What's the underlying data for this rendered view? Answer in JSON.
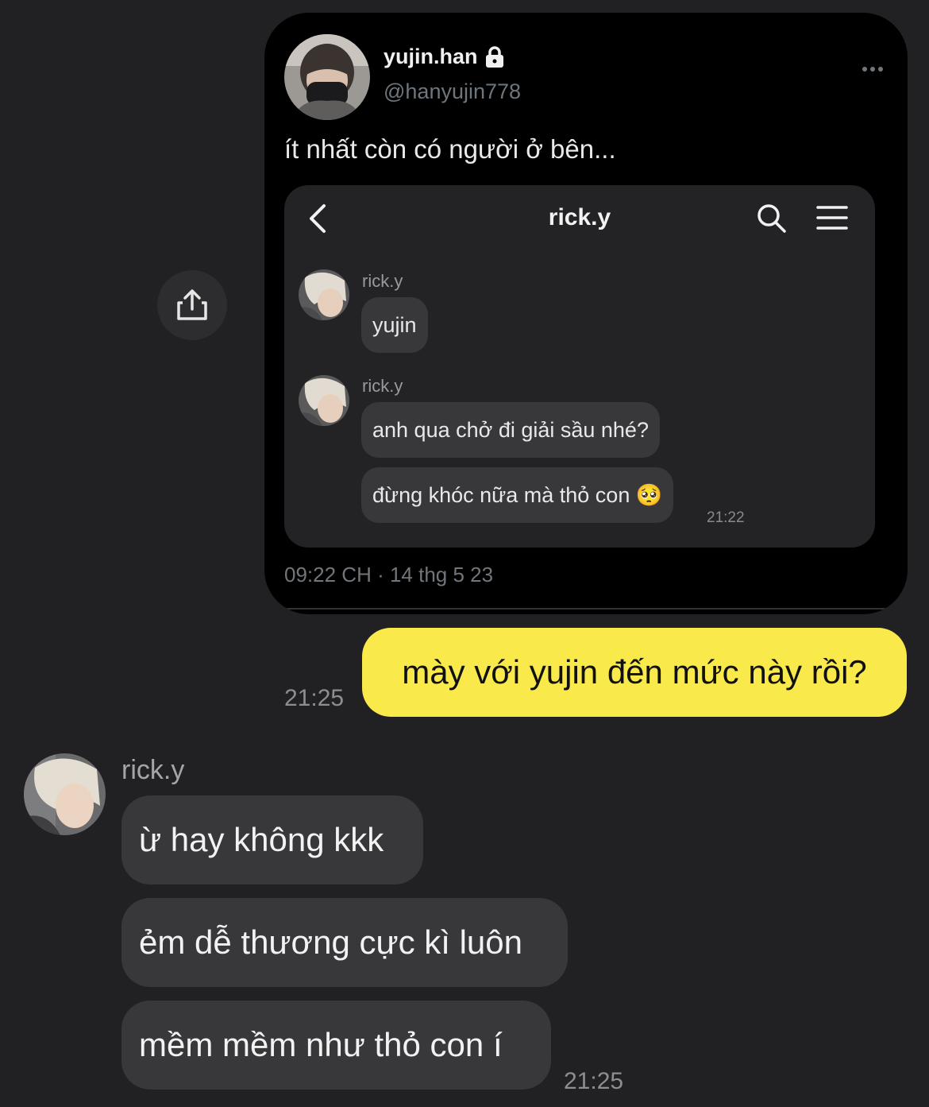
{
  "tweet": {
    "display_name": "yujin.han",
    "handle": "@hanyujin778",
    "text": "ít nhất còn có người ở bên...",
    "timestamp": "09:22 CH · 14 thg 5 23",
    "more_icon": "more-icon",
    "lock_icon": "lock-icon"
  },
  "embed": {
    "title": "rick.y",
    "back_icon": "chevron-left-icon",
    "search_icon": "search-icon",
    "menu_icon": "menu-icon",
    "groups": [
      {
        "sender": "rick.y",
        "messages": [
          "yujin"
        ]
      },
      {
        "sender": "rick.y",
        "messages": [
          "anh qua chở đi giải sầu nhé?",
          "đừng khóc nữa mà thỏ con 🥺"
        ]
      }
    ],
    "time": "21:22"
  },
  "share_icon": "share-icon",
  "outgoing": {
    "text": "mày với yujin đến mức này rồi?",
    "time": "21:25",
    "color": "#f9e94a"
  },
  "incoming": {
    "sender": "rick.y",
    "messages": [
      "ừ hay không kkk",
      "ẻm dễ thương cực kì luôn",
      "mềm mềm như thỏ con í"
    ],
    "time": "21:25"
  }
}
